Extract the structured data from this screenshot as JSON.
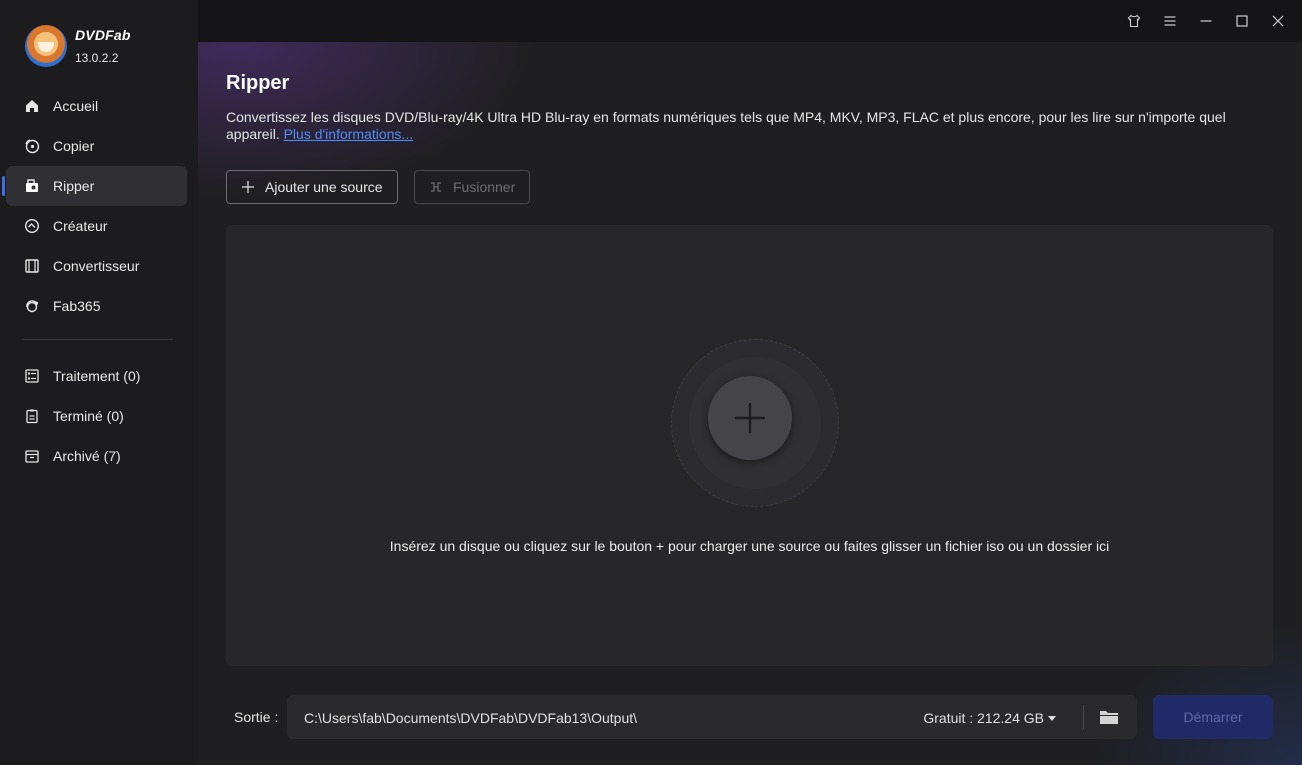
{
  "app": {
    "name": "DVDFab",
    "version": "13.0.2.2"
  },
  "sidebar": {
    "items": [
      {
        "label": "Accueil",
        "icon": "home-icon"
      },
      {
        "label": "Copier",
        "icon": "copy-disc-icon"
      },
      {
        "label": "Ripper",
        "icon": "ripper-icon",
        "active": true
      },
      {
        "label": "Créateur",
        "icon": "creator-icon"
      },
      {
        "label": "Convertisseur",
        "icon": "converter-icon"
      },
      {
        "label": "Fab365",
        "icon": "fab365-icon"
      }
    ],
    "queue": [
      {
        "label": "Traitement (0)",
        "icon": "processing-list-icon"
      },
      {
        "label": "Terminé (0)",
        "icon": "finished-clipboard-icon"
      },
      {
        "label": "Archivé (7)",
        "icon": "archive-box-icon"
      }
    ]
  },
  "titlebar": {
    "icons": [
      "skin-shirt-icon",
      "menu-icon",
      "minimize-icon",
      "maximize-icon",
      "close-icon"
    ]
  },
  "main": {
    "title": "Ripper",
    "description": "Convertissez les disques DVD/Blu-ray/4K Ultra HD Blu-ray en formats numériques tels que MP4, MKV, MP3, FLAC et plus encore, pour les lire sur n'importe quel appareil.",
    "more_info_link": "Plus d'informations...",
    "add_source_label": "Ajouter une source",
    "merge_label": "Fusionner",
    "drop_hint": "Insérez un disque ou cliquez sur le bouton +  pour charger une source ou faites glisser un fichier iso ou un dossier ici"
  },
  "output": {
    "label": "Sortie :",
    "path": "C:\\Users\\fab\\Documents\\DVDFab\\DVDFab13\\Output\\",
    "free_space": "Gratuit : 212.24 GB",
    "start_label": "Démarrer"
  },
  "colors": {
    "accent": "#3f6ae8",
    "link": "#4f8cff",
    "start_button": "#1f2a66"
  }
}
